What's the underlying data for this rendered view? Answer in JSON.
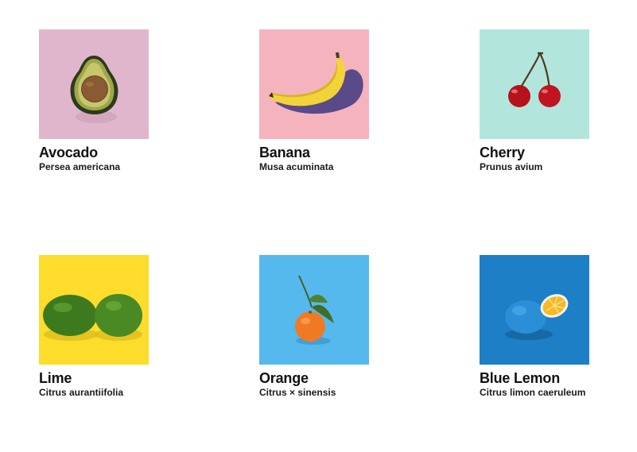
{
  "fruits": [
    {
      "name": "Avocado",
      "latin": "Persea americana",
      "icon": "avocado-icon",
      "background": "#e0b6cc"
    },
    {
      "name": "Banana",
      "latin": "Musa acuminata",
      "icon": "banana-icon",
      "background": "#f5b3be"
    },
    {
      "name": "Cherry",
      "latin": "Prunus avium",
      "icon": "cherry-icon",
      "background": "#b2e6dd"
    },
    {
      "name": "Lime",
      "latin": "Citrus aurantiifolia",
      "icon": "lime-icon",
      "background": "#fddc2c"
    },
    {
      "name": "Orange",
      "latin": "Citrus × sinensis",
      "icon": "orange-icon",
      "background": "#55b9ee"
    },
    {
      "name": "Blue Lemon",
      "latin": "Citrus limon caeruleum",
      "icon": "blue-lemon-icon",
      "background": "#1d7fc6"
    }
  ]
}
